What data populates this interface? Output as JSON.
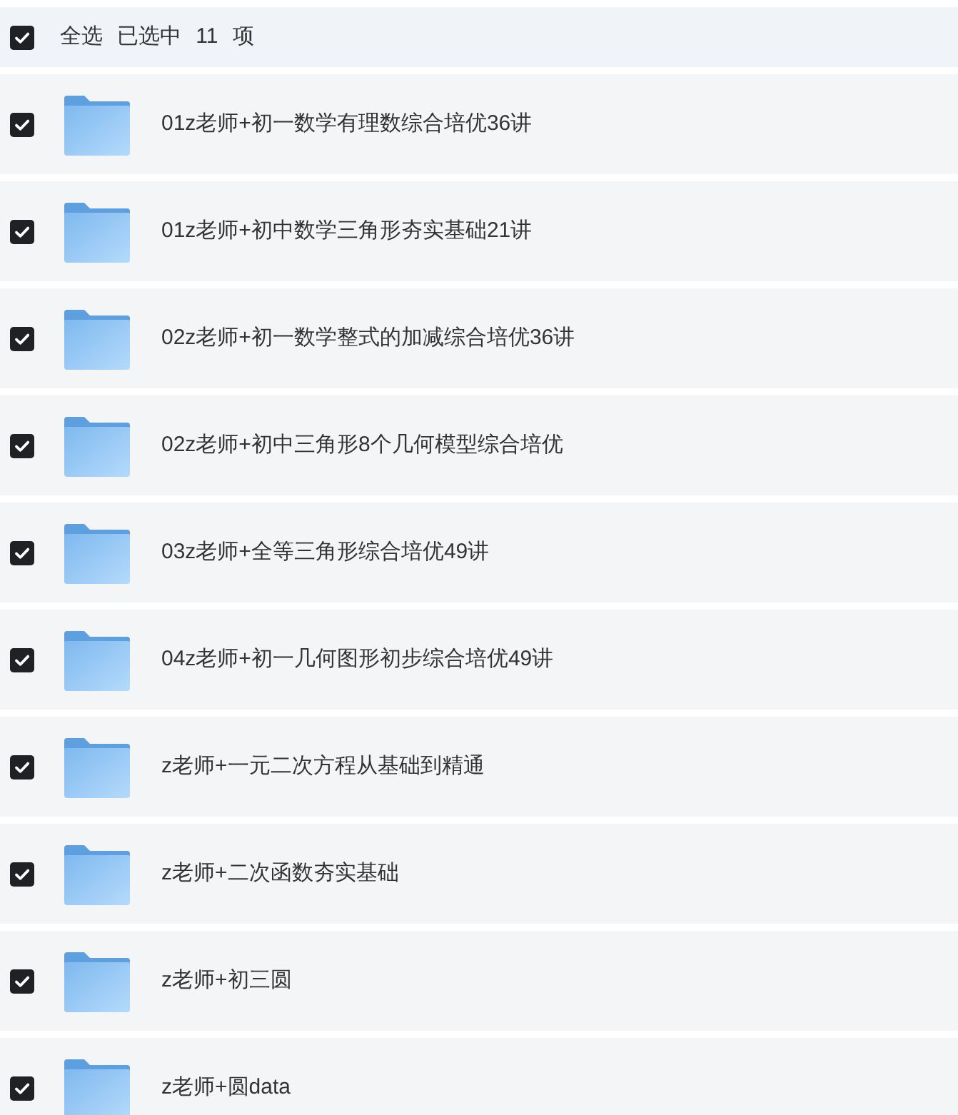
{
  "header": {
    "select_all": {
      "label": "全选",
      "checked": true
    },
    "selection_status": "已选中 11 项"
  },
  "items": [
    {
      "name": "01z老师+初一数学有理数综合培优36讲",
      "checked": true
    },
    {
      "name": "01z老师+初中数学三角形夯实基础21讲",
      "checked": true
    },
    {
      "name": "02z老师+初一数学整式的加减综合培优36讲",
      "checked": true
    },
    {
      "name": "02z老师+初中三角形8个几何模型综合培优",
      "checked": true
    },
    {
      "name": "03z老师+全等三角形综合培优49讲",
      "checked": true
    },
    {
      "name": "04z老师+初一几何图形初步综合培优49讲",
      "checked": true
    },
    {
      "name": "z老师+一元二次方程从基础到精通",
      "checked": true
    },
    {
      "name": "z老师+二次函数夯实基础",
      "checked": true
    },
    {
      "name": "z老师+初三圆",
      "checked": true
    },
    {
      "name": "z老师+圆data",
      "checked": true
    }
  ]
}
